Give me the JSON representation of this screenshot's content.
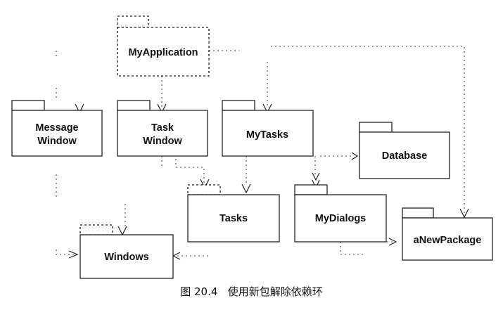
{
  "packages": {
    "my_application": "MyApplication",
    "message_window": [
      "Message",
      "Window"
    ],
    "task_window": [
      "Task",
      "Window"
    ],
    "my_tasks": "MyTasks",
    "database": "Database",
    "tasks": "Tasks",
    "my_dialogs": "MyDialogs",
    "windows": "Windows",
    "a_new_package": "aNewPackage"
  },
  "caption": "图 20.4   使用新包解除依赖环"
}
